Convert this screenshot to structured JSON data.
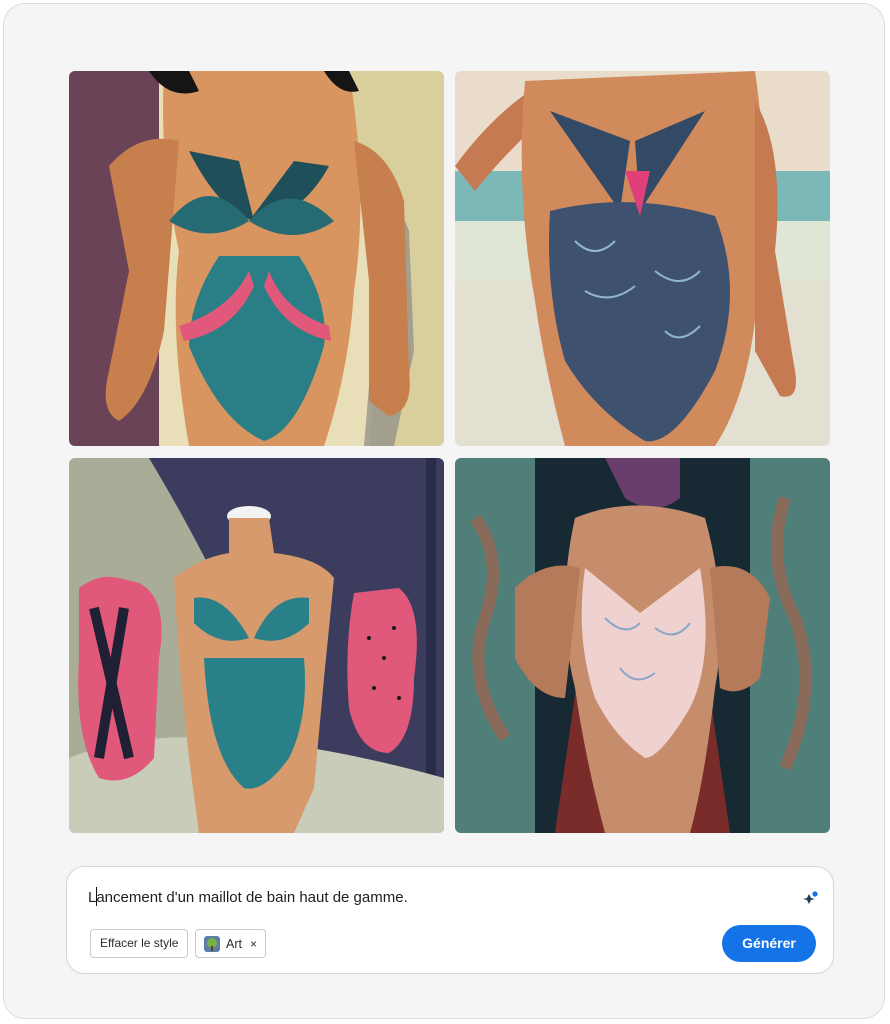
{
  "gallery": {
    "images": [
      {
        "subject": "teal-bikini-figure"
      },
      {
        "subject": "blue-patterned-monokini-figure"
      },
      {
        "subject": "mannequins-swimsuits"
      },
      {
        "subject": "pale-pink-swimsuit-figure"
      }
    ]
  },
  "prompt": {
    "text": "Lancement d'un maillot de bain haut de gamme.",
    "clear_style_label": "Effacer le style",
    "style_chip_label": "Art",
    "style_chip_close": "×",
    "generate_label": "Générer",
    "sparkle_icon": "sparkle-icon"
  },
  "colors": {
    "accent": "#1473e6",
    "teal": "#2a7f86",
    "pink": "#e0587a"
  }
}
